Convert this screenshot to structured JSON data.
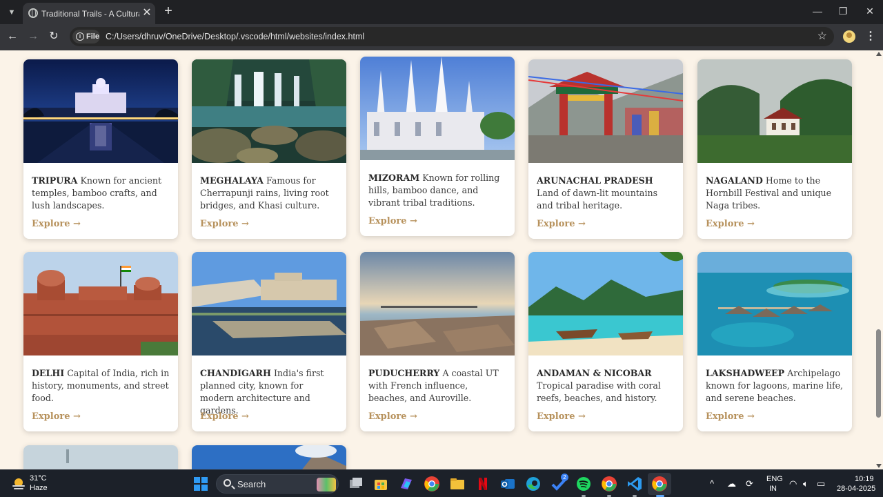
{
  "browser": {
    "tab_title": "Traditional Trails - A Cultural Jou",
    "tab_close": "✕",
    "new_tab": "+",
    "site_info_label": "File",
    "url": "C:/Users/dhruv/OneDrive/Desktop/.vscode/html/websites/index.html",
    "window_controls": {
      "minimize": "—",
      "maximize": "❐",
      "close": "✕"
    }
  },
  "cards_row1": [
    {
      "name": "TRIPURA",
      "desc": "Known for ancient temples, bamboo crafts, and lush landscapes.",
      "link": "Explore →",
      "photo": "palace-night"
    },
    {
      "name": "MEGHALAYA",
      "desc": "Famous for Cherrapunji rains, living root bridges, and Khasi culture.",
      "link": "Explore →",
      "photo": "waterfall"
    },
    {
      "name": "MIZORAM",
      "desc": "Known for rolling hills, bamboo dance, and vibrant tribal traditions.",
      "link": "Explore →",
      "photo": "white-church"
    },
    {
      "name": "ARUNACHAL PRADESH",
      "desc": "Land of dawn-lit mountains and tribal heritage.",
      "link": "Explore →",
      "photo": "monastery-gate"
    },
    {
      "name": "NAGALAND",
      "desc": "Home to the Hornbill Festival and unique Naga tribes.",
      "link": "Explore →",
      "photo": "green-hills"
    }
  ],
  "cards_row2": [
    {
      "name": "DELHI",
      "desc": "Capital of India, rich in history, monuments, and street food.",
      "link": "Explore →",
      "photo": "red-fort"
    },
    {
      "name": "CHANDIGARH",
      "desc": "India's first planned city, known for modern architecture and gardens.",
      "link": "Explore →",
      "photo": "modern-architecture"
    },
    {
      "name": "PUDUCHERRY",
      "desc": "A coastal UT with French influence, beaches, and Auroville.",
      "link": "Explore →",
      "photo": "rocky-shore"
    },
    {
      "name": "ANDAMAN & NICOBAR",
      "desc": "Tropical paradise with coral reefs, beaches, and history.",
      "link": "Explore →",
      "photo": "tropical-bay"
    },
    {
      "name": "LAKSHADWEEP",
      "desc": "Archipelago known for lagoons, marine life, and serene beaches.",
      "link": "Explore →",
      "photo": "water-villas"
    }
  ],
  "taskbar": {
    "weather_temp": "31°C",
    "weather_desc": "Haze",
    "search_label": "Search",
    "store_badge": "2",
    "lang_line1": "ENG",
    "lang_line2": "IN",
    "time": "10:19",
    "date": "28-04-2025"
  },
  "colors": {
    "page_bg": "#fbf3e8",
    "accent_link": "#b7925d",
    "card_bg": "#ffffff"
  }
}
